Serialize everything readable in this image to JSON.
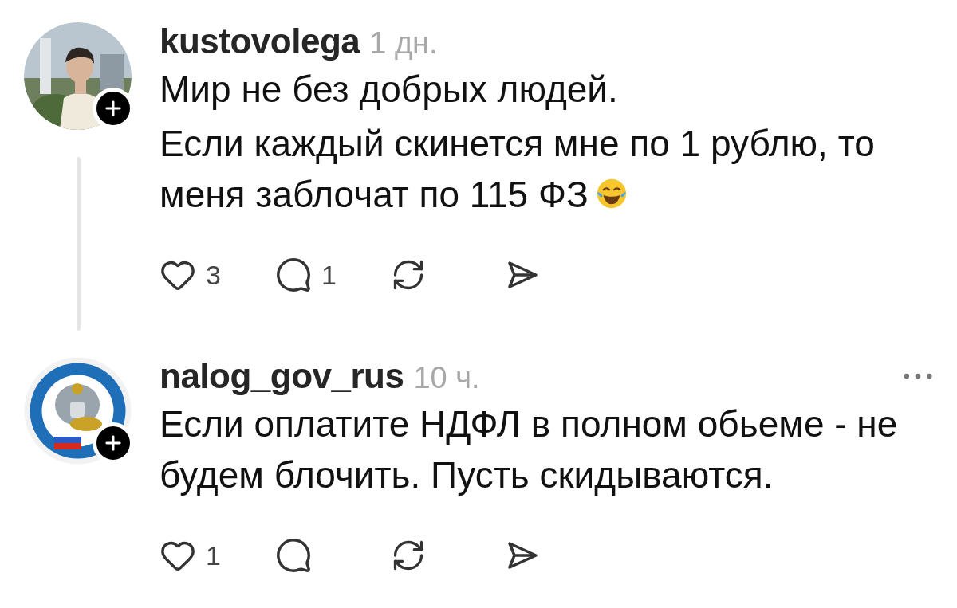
{
  "comments": [
    {
      "username": "kustovolega",
      "time": "1 дн.",
      "avatar": {
        "kind": "picture"
      },
      "thread_line": true,
      "menu": false,
      "paragraphs": [
        {
          "text": "Мир не без добрых людей.",
          "emoji": false
        },
        {
          "text": "Если каждый скинется мне по 1 рублю, то меня заблочат по 115 ФЗ",
          "emoji": true
        }
      ],
      "likes": "3",
      "replies": "1"
    },
    {
      "username": "nalog_gov_rus",
      "time": "10 ч.",
      "avatar": {
        "kind": "picture"
      },
      "thread_line": false,
      "menu": true,
      "paragraphs": [
        {
          "text": "Если оплатите НДФЛ в полном обьеме - не будем блочить. Пусть скидываются.",
          "emoji": false
        }
      ],
      "likes": "1"
    }
  ]
}
